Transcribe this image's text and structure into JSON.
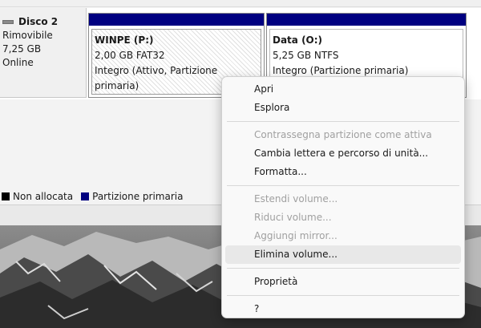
{
  "disk": {
    "name": "Disco 2",
    "type": "Rimovibile",
    "size": "7,25 GB",
    "status": "Online",
    "icon": "disk-drive-icon"
  },
  "partitions": [
    {
      "title": "WINPE  (P:)",
      "size_fs": "2,00 GB FAT32",
      "health": "Integro (Attivo, Partizione primaria)"
    },
    {
      "title": "Data  (O:)",
      "size_fs": "5,25 GB NTFS",
      "health": "Integro (Partizione primaria)"
    }
  ],
  "legend": {
    "unallocated": "Non allocata",
    "primary": "Partizione primaria",
    "colors": {
      "unallocated": "#000000",
      "primary": "#000080"
    }
  },
  "context_menu": {
    "items": [
      {
        "label": "Apri",
        "enabled": true
      },
      {
        "label": "Esplora",
        "enabled": true
      },
      {
        "label": "Contrassegna partizione come attiva",
        "enabled": false
      },
      {
        "label": "Cambia lettera e percorso di unità...",
        "enabled": true
      },
      {
        "label": "Formatta...",
        "enabled": true
      },
      {
        "label": "Estendi volume...",
        "enabled": false
      },
      {
        "label": "Riduci volume...",
        "enabled": false
      },
      {
        "label": "Aggiungi mirror...",
        "enabled": false
      },
      {
        "label": "Elimina volume...",
        "enabled": true,
        "highlighted": true
      },
      {
        "label": "Proprietà",
        "enabled": true
      },
      {
        "label": "?",
        "enabled": true
      }
    ]
  }
}
